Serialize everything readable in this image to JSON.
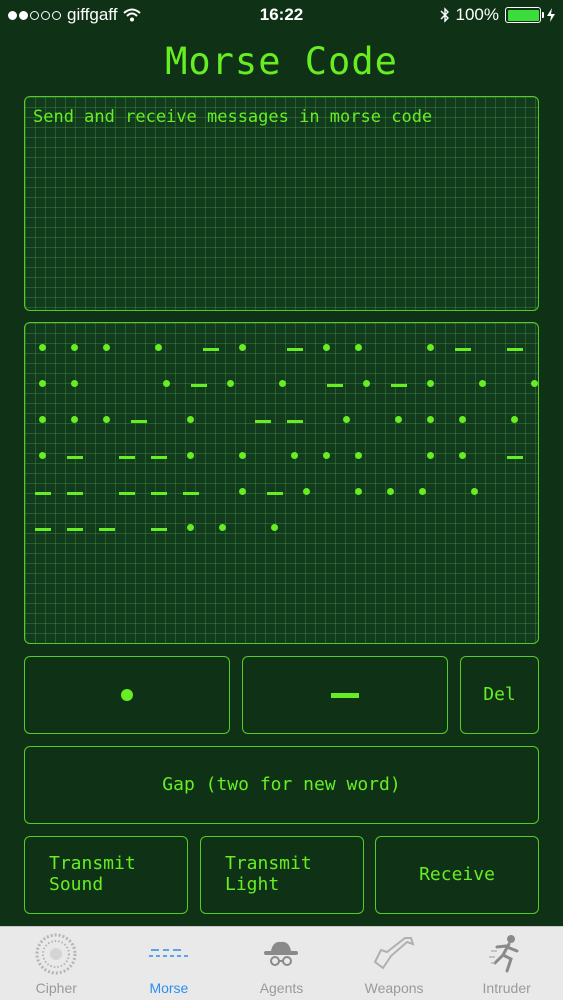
{
  "status": {
    "carrier": "giffgaff",
    "time": "16:22",
    "battery": "100%",
    "signal_bars": 2
  },
  "title": "Morse Code",
  "message_text": "Send and receive messages in morse code",
  "morse_rows": [
    ". . .   .   - .   - . .     . -   - .   -",
    ". .       . - .   .   - . - .   .   . .",
    ". . . -   .     - -   .   . . .   .   . . .",
    ". -   - - .   .   . . .     . .   - .",
    "- -   - - -   . - .   . . .   .     - . - .",
    "- - -   - . .   ."
  ],
  "buttons": {
    "dot_label": "•",
    "dash_label": "—",
    "del": "Del",
    "gap": "Gap (two for new word)",
    "transmit_sound": "Transmit\nSound",
    "transmit_light": "Transmit\nLight",
    "receive": "Receive"
  },
  "tabs": [
    {
      "label": "Cipher",
      "icon": "cipher-wheel-icon",
      "active": false
    },
    {
      "label": "Morse",
      "icon": "morse-icon",
      "active": true
    },
    {
      "label": "Agents",
      "icon": "spy-hat-icon",
      "active": false
    },
    {
      "label": "Weapons",
      "icon": "pistol-icon",
      "active": false
    },
    {
      "label": "Intruder",
      "icon": "running-man-icon",
      "active": false
    }
  ],
  "colors": {
    "accent": "#66ee22",
    "background": "#0f3217",
    "tab_active": "#2b8ef0",
    "tab_inactive": "#9a9a9a"
  }
}
